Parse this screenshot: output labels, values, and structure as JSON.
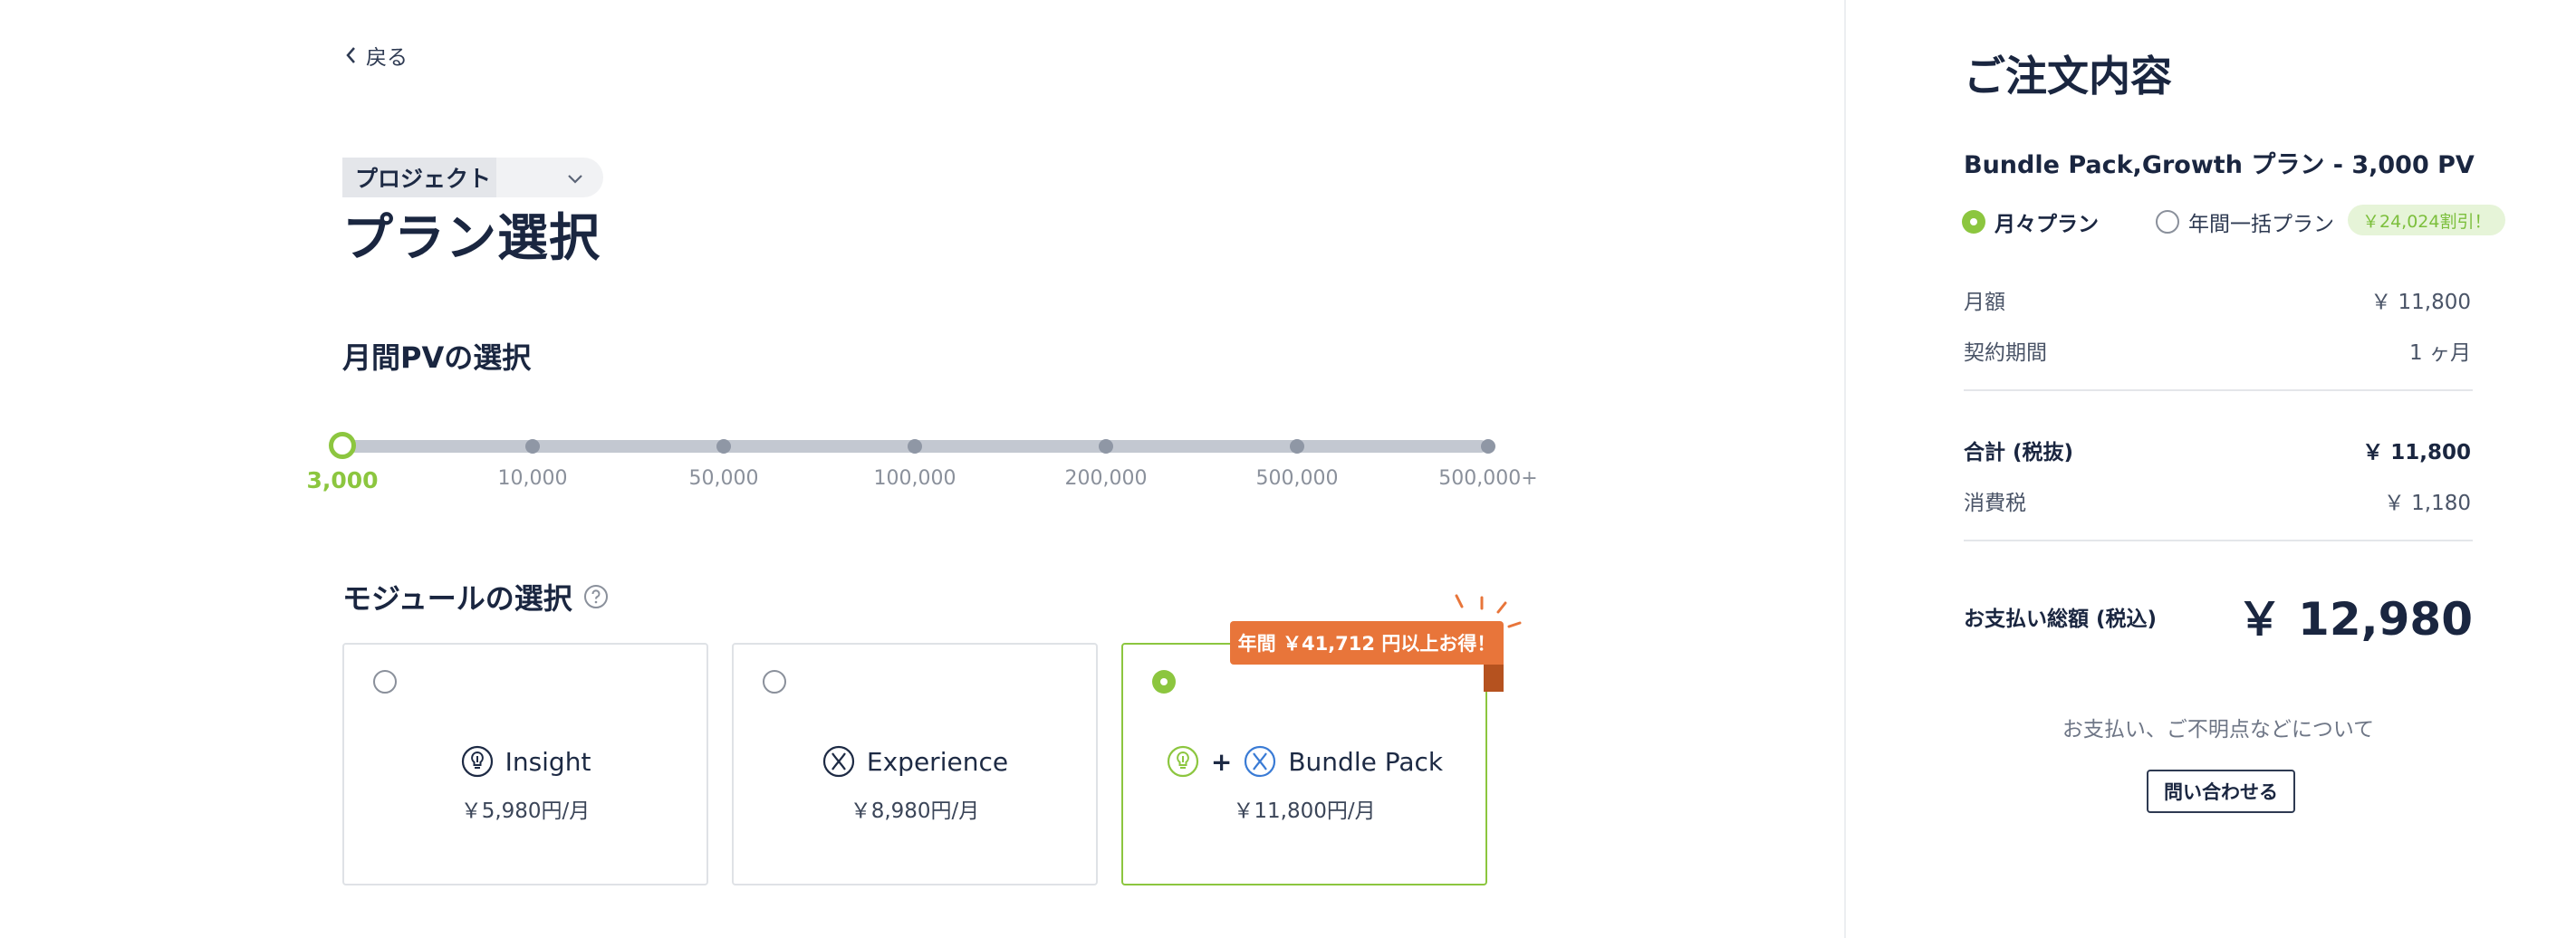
{
  "nav": {
    "back_label": "戻る"
  },
  "header": {
    "project_label": "プロジェクト",
    "page_title": "プラン選択"
  },
  "pv_section": {
    "title": "月間PVの選択",
    "options": [
      "3,000",
      "10,000",
      "50,000",
      "100,000",
      "200,000",
      "500,000",
      "500,000+"
    ],
    "selected": "3,000"
  },
  "module_section": {
    "title": "モジュールの選択",
    "cards": [
      {
        "name": "Insight",
        "price": "￥5,980円/月",
        "selected": false,
        "icon": "insight-icon"
      },
      {
        "name": "Experience",
        "price": "￥8,980円/月",
        "selected": false,
        "icon": "experience-icon"
      },
      {
        "name": "Bundle Pack",
        "plus": "+",
        "price": "￥11,800円/月",
        "selected": true,
        "icon": "bundle-icon"
      }
    ],
    "ribbon": "年間 ￥41,712 円以上お得！"
  },
  "order": {
    "title": "ご注文内容",
    "plan_name": "Bundle Pack,Growth プラン - 3,000 PV",
    "billing_options": [
      {
        "label": "月々プラン",
        "selected": true
      },
      {
        "label": "年間一括プラン",
        "selected": false
      }
    ],
    "discount_badge": "￥24,024割引！",
    "monthly_label": "月額",
    "monthly_value": "￥ 11,800",
    "period_label": "契約期間",
    "period_value": "1 ヶ月",
    "subtotal_label": "合計 (税抜)",
    "subtotal_value": "￥ 11,800",
    "tax_label": "消費税",
    "tax_value": "￥ 1,180",
    "total_label": "お支払い総額 (税込)",
    "total_value": "￥ 12,980",
    "question_text": "お支払い、ご不明点などについて",
    "contact_label": "問い合わせる"
  },
  "colors": {
    "accent_green": "#8cc63f",
    "ribbon_orange": "#e8753a",
    "text_dark": "#1a2640",
    "icon_blue": "#3a7bd5"
  }
}
